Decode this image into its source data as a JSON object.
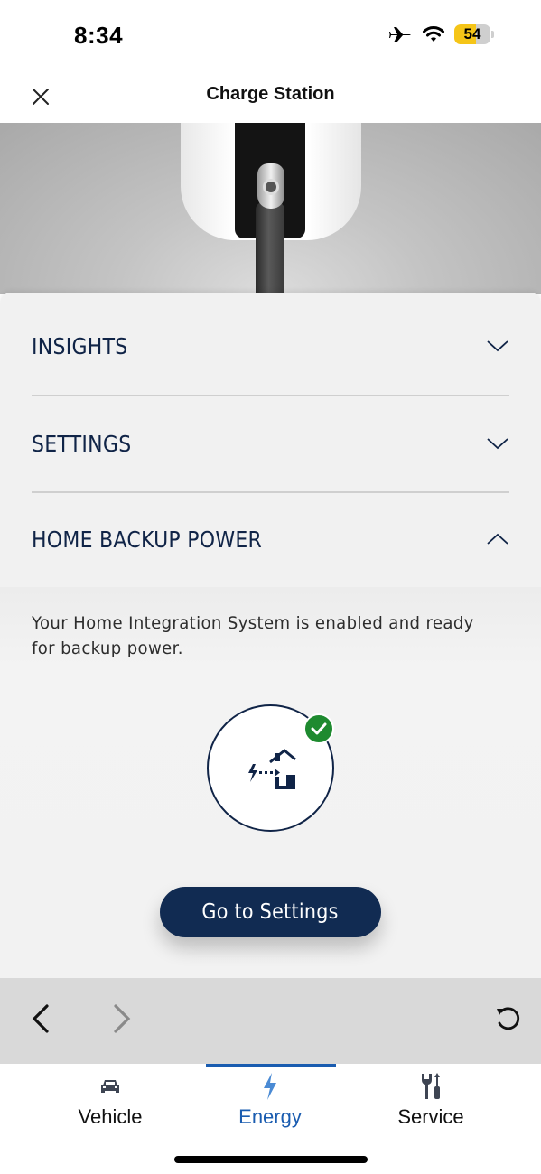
{
  "status_bar": {
    "time": "8:34",
    "airplane_mode": true,
    "wifi": true,
    "battery_percent": "54",
    "battery_color": "#f5c518"
  },
  "header": {
    "title": "Charge Station",
    "close_icon": "close-icon"
  },
  "hero": {
    "image": "charge-station-photo"
  },
  "accordion": {
    "items": [
      {
        "label": "INSIGHTS",
        "expanded": false,
        "icon": "chevron-down-icon"
      },
      {
        "label": "SETTINGS",
        "expanded": false,
        "icon": "chevron-down-icon"
      },
      {
        "label": "HOME BACKUP POWER",
        "expanded": true,
        "icon": "chevron-up-icon"
      }
    ]
  },
  "home_backup": {
    "description": "Your Home Integration System is enabled and ready for backup power.",
    "status_icon": "home-power-transfer-icon",
    "status_badge": "check-icon",
    "status_color": "#1e8a2f",
    "button_label": "Go to Settings"
  },
  "browser_nav": {
    "back_icon": "chevron-left-icon",
    "forward_icon": "chevron-right-icon",
    "reload_icon": "reload-icon"
  },
  "tab_bar": {
    "active": "Energy",
    "accent_color": "#1a5cb0",
    "tabs": [
      {
        "label": "Vehicle",
        "icon": "car-icon"
      },
      {
        "label": "Energy",
        "icon": "bolt-icon"
      },
      {
        "label": "Service",
        "icon": "tools-icon"
      }
    ]
  },
  "colors": {
    "primary_navy": "#112b52",
    "text_navy": "#102447",
    "card_background": "#f1f1f1"
  }
}
